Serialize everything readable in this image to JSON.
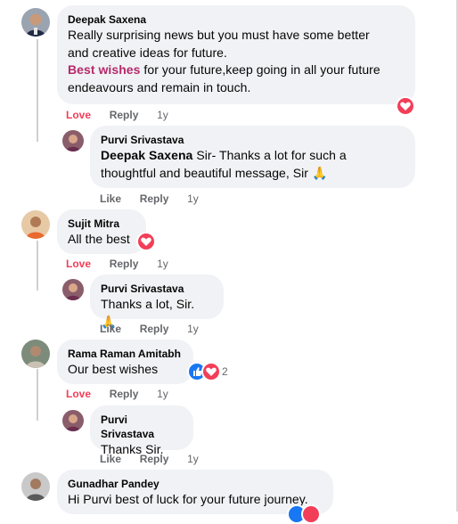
{
  "colors": {
    "love": "#f33e58",
    "like": "#1877f2",
    "bubble": "#f0f2f5",
    "highlight": "#b52a6b"
  },
  "comments": [
    {
      "author": "Deepak Saxena",
      "text_lines": [
        "Really surprising news but you must have some better",
        "and creative ideas for future."
      ],
      "highlight": "Best wishes",
      "text_after_highlight": " for your future,keep going in all your future",
      "text_last": "endeavours and remain in touch.",
      "actions": {
        "love": "Love",
        "reply": "Reply",
        "time": "1y"
      },
      "reaction": "heart-icon",
      "reply": {
        "author": "Purvi Srivastava",
        "mention": "Deepak Saxena",
        "text_after_mention": " Sir- Thanks a lot for such a",
        "text_line2": "thoughtful and beautiful message, Sir 🙏",
        "actions": {
          "like": "Like",
          "reply": "Reply",
          "time": "1y"
        }
      }
    },
    {
      "author": "Sujit Mitra",
      "text": "All the best",
      "actions": {
        "love": "Love",
        "reply": "Reply",
        "time": "1y"
      },
      "reply": {
        "author": "Purvi Srivastava",
        "text": "Thanks a lot, Sir. 🙏",
        "actions": {
          "like": "Like",
          "reply": "Reply",
          "time": "1y"
        }
      }
    },
    {
      "author": "Rama Raman Amitabh",
      "text": "Our best wishes",
      "reaction_count": "2",
      "actions": {
        "love": "Love",
        "reply": "Reply",
        "time": "1y"
      },
      "reply": {
        "author": "Purvi Srivastava",
        "text": "Thanks Sir.",
        "actions": {
          "like": "Like",
          "reply": "Reply",
          "time": "1y"
        }
      }
    },
    {
      "author": "Gunadhar Pandey",
      "text": "Hi Purvi best of luck for your future journey."
    }
  ]
}
